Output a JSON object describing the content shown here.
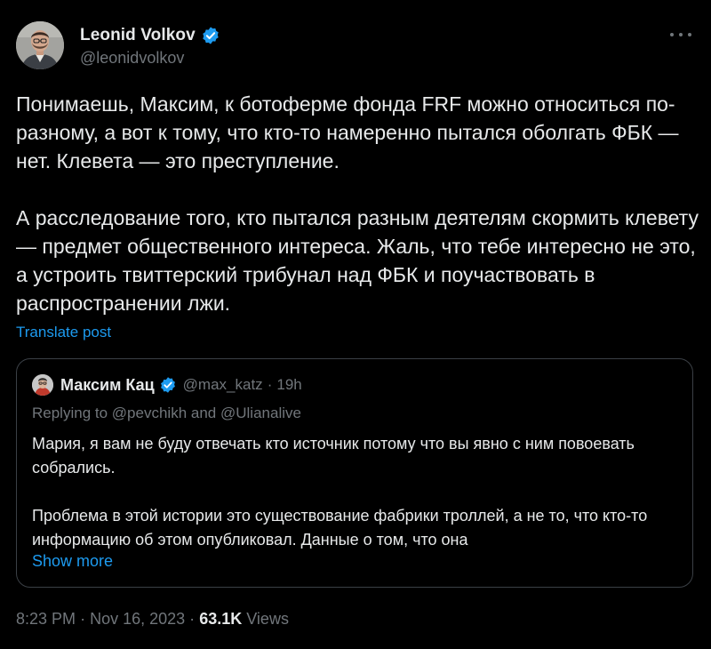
{
  "theme": {
    "background": "#000000",
    "text": "#e7e9ea",
    "secondary": "#71767b",
    "link": "#1d9bf0",
    "border": "#3b4046",
    "verified": "#1d9bf0"
  },
  "author": {
    "name": "Leonid Volkov",
    "handle": "@leonidvolkov",
    "verified": true,
    "avatar_icon": "avatar-photo"
  },
  "more_icon": "more-horizontal-icon",
  "post": {
    "paragraphs": [
      "Понимаешь, Максим, к ботоферме фонда FRF можно относиться по-разному, а вот к тому, что кто-то намеренно пытался оболгать ФБК — нет. Клевета — это преступление.",
      "А расследование того, кто пытался разным деятелям скормить клевету — предмет общественного интереса. Жаль, что тебе интересно не это, а устроить твиттерский трибунал над ФБК и поучаствовать в распространении лжи."
    ],
    "translate_label": "Translate post"
  },
  "quote": {
    "author_name": "Максим Кац",
    "author_handle": "@max_katz",
    "separator": "·",
    "time": "19h",
    "verified": true,
    "replying_prefix": "Replying to",
    "replying_to": [
      "@pevchikh",
      "@Ulianalive"
    ],
    "replying_and": "and",
    "paragraphs": [
      "Мария, я вам не буду отвечать кто источник потому что вы явно с ним повоевать собрались.",
      "Проблема в этой истории это существование фабрики троллей, а не то, что кто-то информацию об этом опубликовал. Данные о том, что она"
    ],
    "show_more_label": "Show more"
  },
  "meta": {
    "time": "8:23 PM",
    "separator": "·",
    "date": "Nov 16, 2023",
    "views_count": "63.1K",
    "views_label": "Views"
  }
}
